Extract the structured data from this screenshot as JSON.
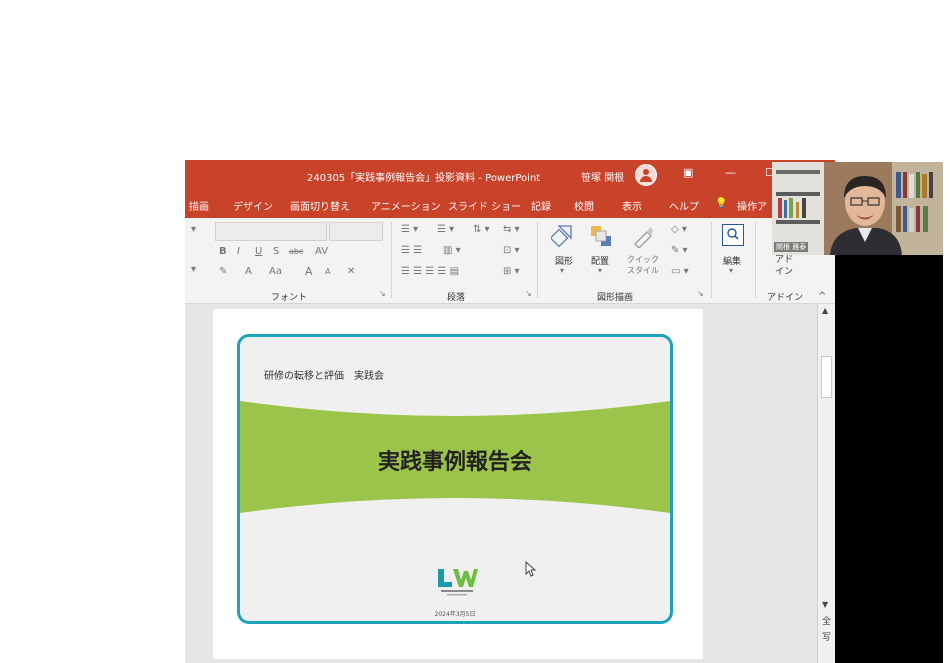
{
  "window": {
    "title": "240305「実践事例報告会」投影資料 - PowerPoint",
    "user_name": "笹塚 関根"
  },
  "ribbon_tabs": [
    "描画",
    "デザイン",
    "画面切り替え",
    "アニメーション",
    "スライド ショー",
    "記録",
    "校閲",
    "表示",
    "ヘルプ",
    "操作ア"
  ],
  "ribbon": {
    "groups": {
      "font": "フォント",
      "paragraph": "段落",
      "drawing": "図形描画",
      "addin": "アドイン"
    },
    "buttons": {
      "shapes": "図形",
      "arrange": "配置",
      "quick_style": "クイック\nスタイル",
      "edit": "編集",
      "addin": "アド\nイン"
    },
    "font_controls": [
      "B",
      "I",
      "U",
      "S",
      "abc",
      "AV"
    ],
    "font_controls_row2": [
      "A",
      "Aa",
      "A",
      "A"
    ]
  },
  "slide": {
    "subtitle": "研修の転移と評価　実践会",
    "title": "実践事例報告会",
    "logo_text": "LW",
    "date": "2024年3月5日"
  },
  "scrollbar": {
    "chars": [
      "全",
      "写"
    ]
  },
  "video": {
    "participant_name": "関根 雅泰"
  },
  "colors": {
    "accent": "#c8432a",
    "slide_border": "#1ca3b9",
    "band_green": "#9dc44a",
    "logo_green": "#6bbf3f",
    "logo_teal": "#1a9aa9"
  }
}
